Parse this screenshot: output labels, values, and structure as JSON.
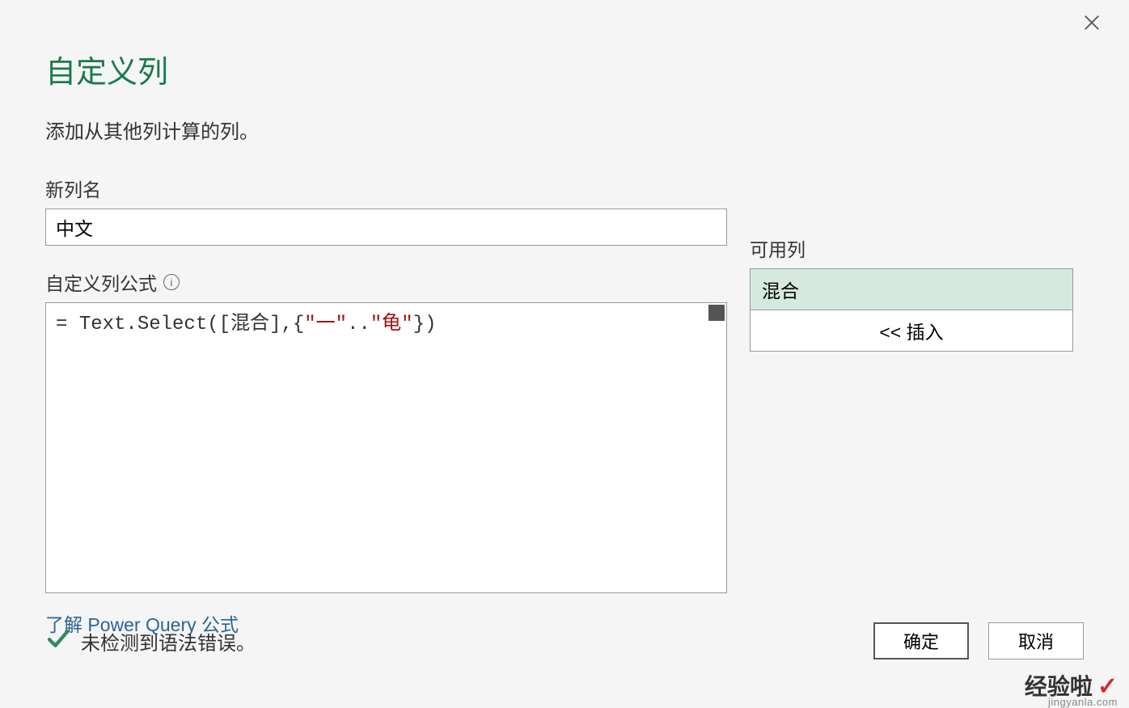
{
  "dialog": {
    "title": "自定义列",
    "subtitle": "添加从其他列计算的列。",
    "new_column_label": "新列名",
    "new_column_value": "中文",
    "formula_label": "自定义列公式",
    "formula": {
      "prefix": "= ",
      "func": "Text.Select",
      "open": "([",
      "col": "混合",
      "mid": "],{",
      "q1": "\"一\"",
      "dots": "..",
      "q2": "\"龟\"",
      "close": "})"
    },
    "help_link": "了解 Power Query 公式",
    "available_label": "可用列",
    "available_items": [
      "混合"
    ],
    "insert_label": "<< 插入",
    "validation_text": "未检测到语法错误。",
    "ok_label": "确定",
    "cancel_label": "取消"
  },
  "watermark": {
    "text": "经验啦",
    "check": "✓",
    "url": "jingyanla.com"
  }
}
